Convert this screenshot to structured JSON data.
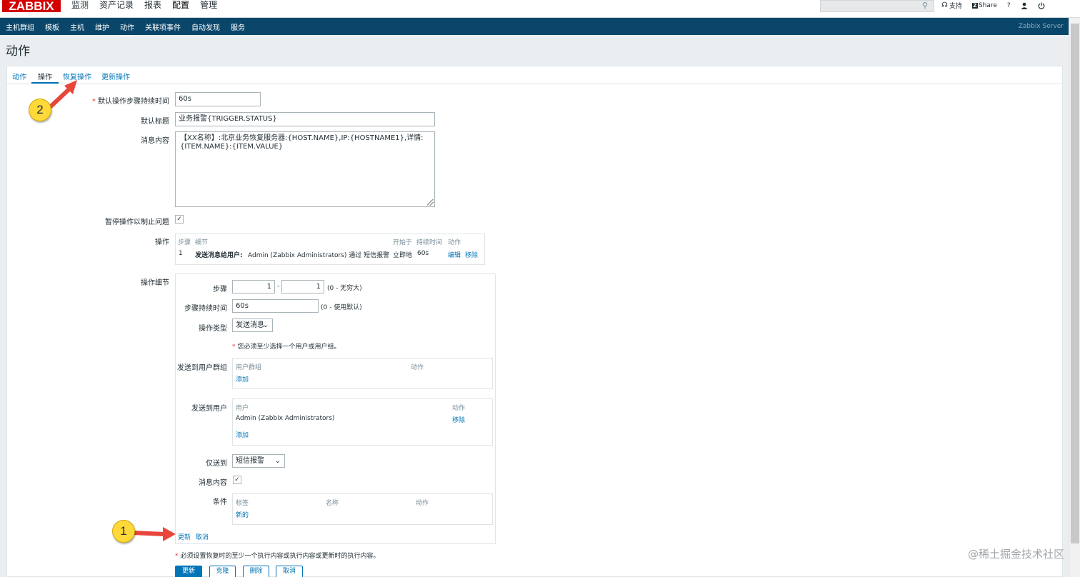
{
  "header": {
    "logo": "ZABBIX",
    "menu": [
      "监测",
      "资产记录",
      "报表",
      "配置",
      "管理"
    ],
    "active_menu": "配置",
    "support": "支持",
    "share": "Share",
    "help": "?",
    "user_icon": "user-icon",
    "power_icon": "power-icon"
  },
  "subnav": {
    "items": [
      "主机群组",
      "模板",
      "主机",
      "维护",
      "动作",
      "关联项事件",
      "自动发现",
      "服务"
    ],
    "active": "动作",
    "server": "Zabbix Server"
  },
  "page": {
    "title": "动作"
  },
  "tabs": [
    "动作",
    "操作",
    "恢复操作",
    "更新操作"
  ],
  "active_tab": "操作",
  "form": {
    "default_step_duration_label": "默认操作步骤持续时间",
    "default_step_duration_value": "60s",
    "default_subject_label": "默认标题",
    "default_subject_value": "业务报警{TRIGGER.STATUS}",
    "message_label": "消息内容",
    "message_value": "【XX名称】:北京业务恢复服务器:{HOST.NAME},IP:{HOSTNAME1},详情:\n{ITEM.NAME}:{ITEM.VALUE}",
    "pause_label": "暂停操作以制止问题",
    "pause_checked": "✓",
    "operations_label": "操作",
    "operations_table": {
      "headers": [
        "步骤",
        "细节",
        "开始于",
        "持续时间",
        "动作"
      ],
      "row": {
        "step": "1",
        "detail_bold": "发送消息给用户:",
        "detail_rest": "Admin (Zabbix Administrators) 通过 短信报警",
        "start": "立即地",
        "duration": "60s",
        "edit": "编辑",
        "remove": "移除"
      }
    },
    "operation_details_label": "操作细节",
    "details": {
      "steps_label": "步骤",
      "step_from": "1",
      "step_sep": "-",
      "step_to": "1",
      "step_hint": "(0 - 无穷大)",
      "step_duration_label": "步骤持续时间",
      "step_duration_value": "60s",
      "step_duration_hint": "(0 - 使用默认)",
      "op_type_label": "操作类型",
      "op_type_value": "发送消息",
      "must_select_note": "您必须至少选择一个用户或用户组。",
      "send_groups_label": "发送到用户群组",
      "groups_headers": [
        "用户群组",
        "动作"
      ],
      "groups_add": "添加",
      "send_users_label": "发送到用户",
      "users_headers": [
        "用户",
        "动作"
      ],
      "users_row_name": "Admin (Zabbix Administrators)",
      "users_row_remove": "移除",
      "users_add": "添加",
      "send_only_label": "仅送到",
      "send_only_value": "短信报警",
      "default_msg_label": "消息内容",
      "default_msg_checked": "✓",
      "conditions_label": "条件",
      "conditions_headers": [
        "标签",
        "名称",
        "动作"
      ],
      "conditions_new": "新的",
      "update_link": "更新",
      "cancel_link": "取消"
    },
    "bottom_note": "必须设置恢复时的至少一个执行内容或执行内容或更新时的执行内容。",
    "buttons": [
      "更新",
      "克隆",
      "删除",
      "取消"
    ]
  },
  "annotations": {
    "marker1": "1",
    "marker2": "2"
  },
  "watermark": "@稀土掘金技术社区",
  "colors": {
    "accent": "#0275b8",
    "nav": "#0a466a",
    "logo": "#d40000",
    "marker": "#ffd83a",
    "arrow": "#e8463a"
  }
}
